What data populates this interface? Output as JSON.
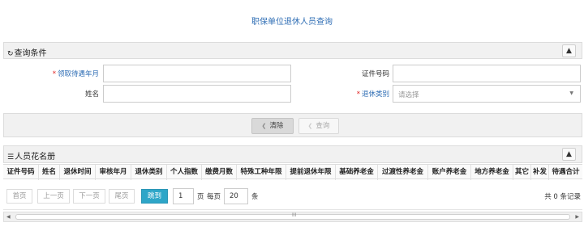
{
  "page": {
    "title": "职保单位退休人员查询"
  },
  "query_panel": {
    "title": "查询条件",
    "fields": {
      "claim_month_label": "领取待遇年月",
      "id_number_label": "证件号码",
      "name_label": "姓名",
      "retire_type_label": "退休类别",
      "retire_type_placeholder": "请选择",
      "required_mark": "*"
    },
    "buttons": {
      "clear": "清除",
      "query": "查询"
    }
  },
  "roster_panel": {
    "title": "人员花名册",
    "columns": [
      "证件号码",
      "姓名",
      "退休时间",
      "审核年月",
      "退休类别",
      "个人指数",
      "缴费月数",
      "特殊工种年限",
      "提前退休年限",
      "基础养老金",
      "过渡性养老金",
      "账户养老金",
      "地方养老金",
      "其它",
      "补发",
      "待遇合计"
    ]
  },
  "pager": {
    "first": "首页",
    "prev": "上一页",
    "next": "下一页",
    "last": "尾页",
    "jump": "跳到",
    "page_value": "1",
    "page_unit": "页",
    "per_page_label": "每页",
    "per_page_value": "20",
    "per_page_unit": "条",
    "total": "共 0 条记录"
  },
  "scrollbar": {
    "grip": "III"
  }
}
